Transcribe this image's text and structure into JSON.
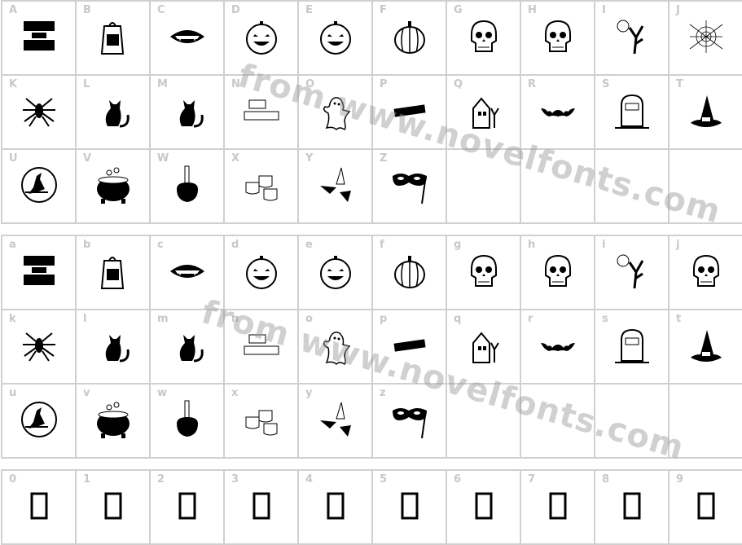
{
  "watermark": "from www.novelfonts.com",
  "blocks": [
    {
      "cells": [
        {
          "label": "A",
          "icon": "trick-or-treat-icon"
        },
        {
          "label": "B",
          "icon": "treat-bag-icon"
        },
        {
          "label": "C",
          "icon": "vampire-teeth-icon"
        },
        {
          "label": "D",
          "icon": "jack-o-lantern-icon"
        },
        {
          "label": "E",
          "icon": "jack-o-lantern-icon"
        },
        {
          "label": "F",
          "icon": "pumpkin-icon"
        },
        {
          "label": "G",
          "icon": "skull-icon"
        },
        {
          "label": "H",
          "icon": "skull-icon"
        },
        {
          "label": "I",
          "icon": "spooky-tree-icon"
        },
        {
          "label": "J",
          "icon": "spider-web-icon"
        },
        {
          "label": "K",
          "icon": "spider-icon"
        },
        {
          "label": "L",
          "icon": "black-cat-icon"
        },
        {
          "label": "M",
          "icon": "black-cat-icon"
        },
        {
          "label": "N",
          "icon": "happy-halloween-icon"
        },
        {
          "label": "O",
          "icon": "ghost-icon"
        },
        {
          "label": "P",
          "icon": "boo-icon"
        },
        {
          "label": "Q",
          "icon": "haunted-house-icon"
        },
        {
          "label": "R",
          "icon": "bat-icon"
        },
        {
          "label": "S",
          "icon": "tombstone-icon"
        },
        {
          "label": "T",
          "icon": "witch-hat-icon"
        },
        {
          "label": "U",
          "icon": "witch-moon-icon"
        },
        {
          "label": "V",
          "icon": "cauldron-icon"
        },
        {
          "label": "W",
          "icon": "candy-apple-icon"
        },
        {
          "label": "X",
          "icon": "candy-icon"
        },
        {
          "label": "Y",
          "icon": "candy-corn-icon"
        },
        {
          "label": "Z",
          "icon": "mask-icon"
        },
        {
          "label": "",
          "icon": ""
        },
        {
          "label": "",
          "icon": ""
        },
        {
          "label": "",
          "icon": ""
        },
        {
          "label": "",
          "icon": ""
        }
      ]
    },
    {
      "cells": [
        {
          "label": "a",
          "icon": "trick-or-treat-icon"
        },
        {
          "label": "b",
          "icon": "treat-bag-icon"
        },
        {
          "label": "c",
          "icon": "vampire-teeth-icon"
        },
        {
          "label": "d",
          "icon": "jack-o-lantern-icon"
        },
        {
          "label": "e",
          "icon": "jack-o-lantern-icon"
        },
        {
          "label": "f",
          "icon": "pumpkin-icon"
        },
        {
          "label": "g",
          "icon": "skull-icon"
        },
        {
          "label": "h",
          "icon": "skull-icon"
        },
        {
          "label": "i",
          "icon": "spooky-tree-icon"
        },
        {
          "label": "j",
          "icon": "skull-icon"
        },
        {
          "label": "k",
          "icon": "spider-icon"
        },
        {
          "label": "l",
          "icon": "black-cat-icon"
        },
        {
          "label": "m",
          "icon": "black-cat-icon"
        },
        {
          "label": "n",
          "icon": "happy-halloween-icon"
        },
        {
          "label": "o",
          "icon": "ghost-icon"
        },
        {
          "label": "p",
          "icon": "boo-icon"
        },
        {
          "label": "q",
          "icon": "haunted-house-icon"
        },
        {
          "label": "r",
          "icon": "bat-icon"
        },
        {
          "label": "s",
          "icon": "tombstone-icon"
        },
        {
          "label": "t",
          "icon": "witch-hat-icon"
        },
        {
          "label": "u",
          "icon": "witch-moon-icon"
        },
        {
          "label": "v",
          "icon": "cauldron-icon"
        },
        {
          "label": "w",
          "icon": "candy-apple-icon"
        },
        {
          "label": "x",
          "icon": "candy-icon"
        },
        {
          "label": "y",
          "icon": "candy-corn-icon"
        },
        {
          "label": "z",
          "icon": "mask-icon"
        },
        {
          "label": "",
          "icon": ""
        },
        {
          "label": "",
          "icon": ""
        },
        {
          "label": "",
          "icon": ""
        },
        {
          "label": "",
          "icon": ""
        }
      ]
    },
    {
      "cells": [
        {
          "label": "0",
          "icon": "missing-glyph-icon"
        },
        {
          "label": "1",
          "icon": "missing-glyph-icon"
        },
        {
          "label": "2",
          "icon": "missing-glyph-icon"
        },
        {
          "label": "3",
          "icon": "missing-glyph-icon"
        },
        {
          "label": "4",
          "icon": "missing-glyph-icon"
        },
        {
          "label": "5",
          "icon": "missing-glyph-icon"
        },
        {
          "label": "6",
          "icon": "missing-glyph-icon"
        },
        {
          "label": "7",
          "icon": "missing-glyph-icon"
        },
        {
          "label": "8",
          "icon": "missing-glyph-icon"
        },
        {
          "label": "9",
          "icon": "missing-glyph-icon"
        }
      ]
    }
  ]
}
